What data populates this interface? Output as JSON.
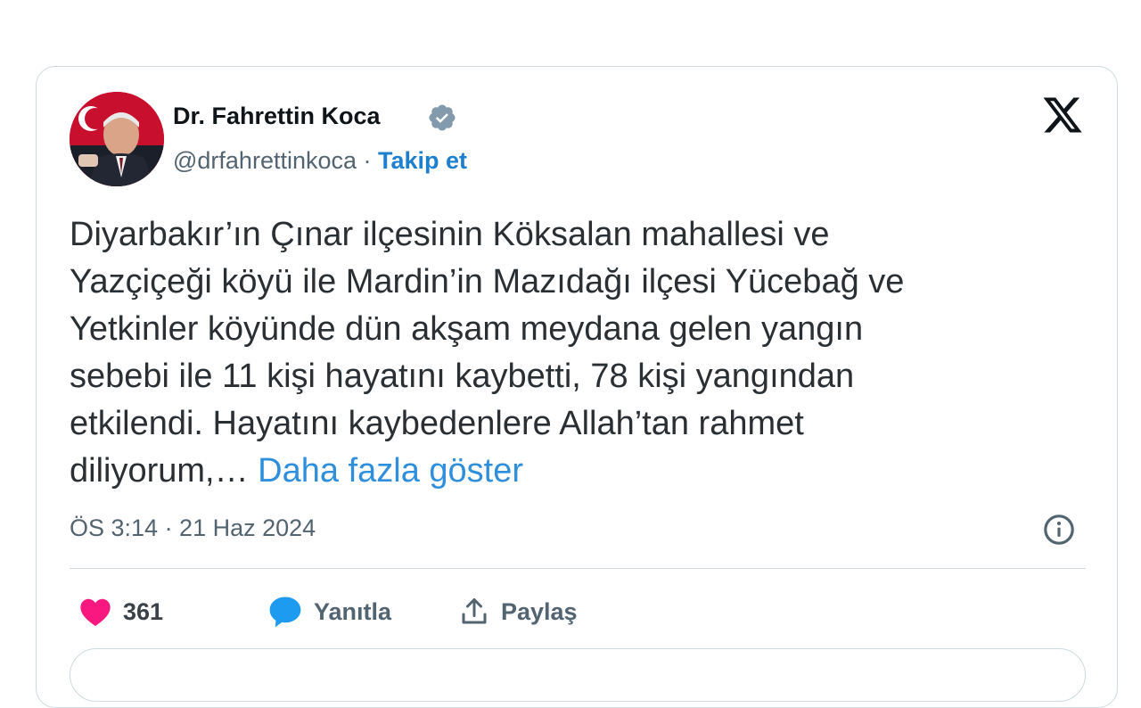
{
  "author": {
    "name": "Dr. Fahrettin Koca",
    "handle": "@drfahrettinkoca",
    "separator": " · ",
    "follow_label": "Takip et",
    "verified_icon": "verified-badge-icon"
  },
  "tweet": {
    "text": "Diyarbakır’ın Çınar ilçesinin Köksalan mahallesi ve\nYazçiçeği köyü ile Mardin’in Mazıdağı ilçesi Yücebağ ve\nYetkinler köyünde dün akşam meydana gelen yangın\nsebebi ile 11 kişi hayatını kaybetti, 78 kişi yangından\netkilendi. Hayatını kaybedenlere Allah’tan rahmet\ndiliyorum,… ",
    "show_more": "Daha fazla göster",
    "timestamp": "ÖS 3:14 · 21 Haz 2024"
  },
  "actions": {
    "like_count": "361",
    "reply_label": "Yanıtla",
    "share_label": "Paylaş"
  },
  "colors": {
    "like": "#f91880",
    "reply": "#1d9bf0",
    "link": "#2f8fdc",
    "verified": "#829aab"
  }
}
